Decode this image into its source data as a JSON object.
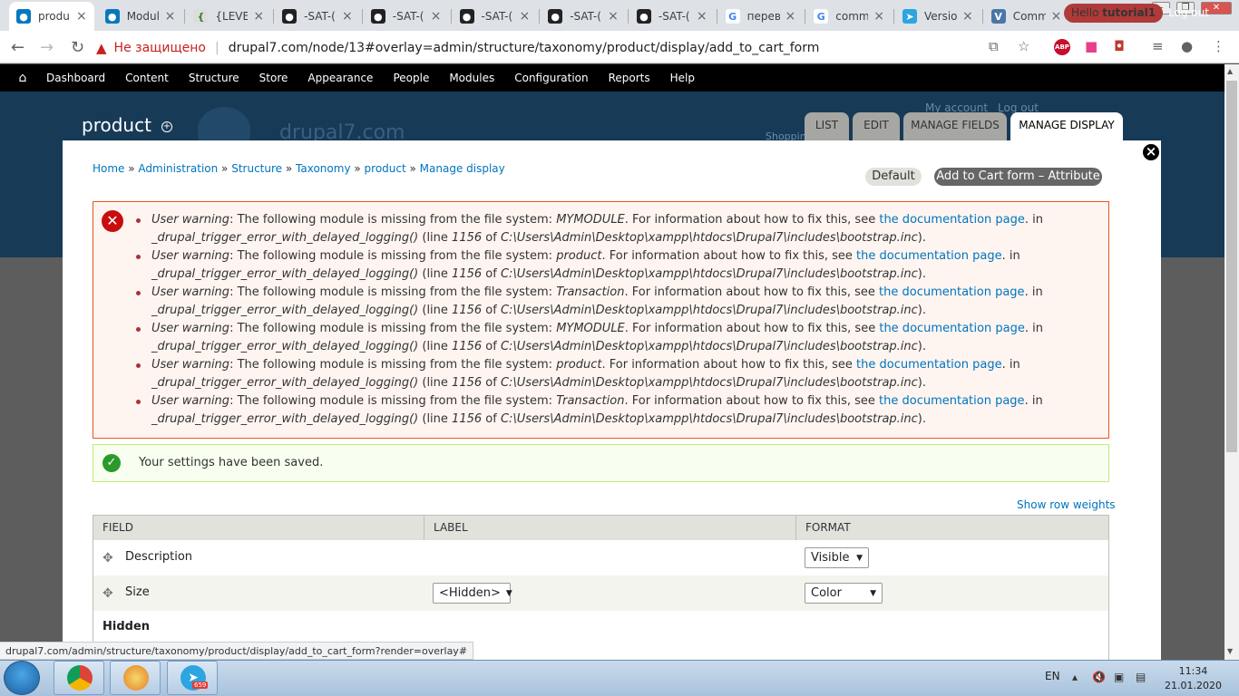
{
  "browser": {
    "tabs": [
      {
        "title": "produ",
        "active": true,
        "icon": "drupal-icon"
      },
      {
        "title": "Modul",
        "icon": "drupal-icon"
      },
      {
        "title": "{LEVEL",
        "icon": "level-icon"
      },
      {
        "title": "-SAT-(",
        "icon": "github-icon"
      },
      {
        "title": "-SAT-(",
        "icon": "github-icon"
      },
      {
        "title": "-SAT-(",
        "icon": "github-icon"
      },
      {
        "title": "-SAT-(",
        "icon": "github-icon"
      },
      {
        "title": "-SAT-(",
        "icon": "github-icon"
      },
      {
        "title": "перев",
        "icon": "google-icon"
      },
      {
        "title": "comm",
        "icon": "google-icon"
      },
      {
        "title": "Versio",
        "icon": "telegram-icon"
      },
      {
        "title": "Comm",
        "icon": "vk-icon"
      }
    ],
    "security_label": "Не защищено",
    "url": "drupal7.com/node/13#overlay=admin/structure/taxonomy/product/display/add_to_cart_form",
    "status_url": "drupal7.com/admin/structure/taxonomy/product/display/add_to_cart_form?render=overlay#"
  },
  "admin_toolbar": {
    "items": [
      "Dashboard",
      "Content",
      "Structure",
      "Store",
      "Appearance",
      "People",
      "Modules",
      "Configuration",
      "Reports",
      "Help"
    ],
    "hello_prefix": "Hello ",
    "hello_user": "tutorial1",
    "logout": "Log out"
  },
  "background": {
    "site_name": "drupal7.com",
    "my_account": "My account",
    "log_out": "Log out",
    "shopping": "Shoppin"
  },
  "overlay": {
    "title": "product",
    "tabs": [
      "LIST",
      "EDIT",
      "MANAGE FIELDS",
      "MANAGE DISPLAY"
    ],
    "breadcrumb": [
      "Home",
      "Administration",
      "Structure",
      "Taxonomy",
      "product",
      "Manage display"
    ],
    "subtabs": [
      "Default",
      "Add to Cart form – Attribute"
    ],
    "messages": {
      "errors": [
        {
          "type": "User warning",
          "text_a": ": The following module is missing from the file system: ",
          "module": "MYMODULE",
          "text_b": ". For information about how to fix this, see ",
          "link": "the documentation page",
          "text_c": ". in ",
          "func": "_drupal_trigger_error_with_delayed_logging()",
          "text_d": " (line ",
          "line": "1156",
          "text_e": " of ",
          "path": "C:\\Users\\Admin\\Desktop\\xampp\\htdocs\\Drupal7\\includes\\bootstrap.inc",
          "text_f": ")."
        },
        {
          "type": "User warning",
          "text_a": ": The following module is missing from the file system: ",
          "module": "product",
          "text_b": ". For information about how to fix this, see ",
          "link": "the documentation page",
          "text_c": ". in ",
          "func": "_drupal_trigger_error_with_delayed_logging()",
          "text_d": " (line ",
          "line": "1156",
          "text_e": " of ",
          "path": "C:\\Users\\Admin\\Desktop\\xampp\\htdocs\\Drupal7\\includes\\bootstrap.inc",
          "text_f": ")."
        },
        {
          "type": "User warning",
          "text_a": ": The following module is missing from the file system: ",
          "module": "Transaction",
          "text_b": ". For information about how to fix this, see ",
          "link": "the documentation page",
          "text_c": ". in ",
          "func": "_drupal_trigger_error_with_delayed_logging()",
          "text_d": " (line ",
          "line": "1156",
          "text_e": " of ",
          "path": "C:\\Users\\Admin\\Desktop\\xampp\\htdocs\\Drupal7\\includes\\bootstrap.inc",
          "text_f": ")."
        },
        {
          "type": "User warning",
          "text_a": ": The following module is missing from the file system: ",
          "module": "MYMODULE",
          "text_b": ". For information about how to fix this, see ",
          "link": "the documentation page",
          "text_c": ". in ",
          "func": "_drupal_trigger_error_with_delayed_logging()",
          "text_d": " (line ",
          "line": "1156",
          "text_e": " of ",
          "path": "C:\\Users\\Admin\\Desktop\\xampp\\htdocs\\Drupal7\\includes\\bootstrap.inc",
          "text_f": ")."
        },
        {
          "type": "User warning",
          "text_a": ": The following module is missing from the file system: ",
          "module": "product",
          "text_b": ". For information about how to fix this, see ",
          "link": "the documentation page",
          "text_c": ". in ",
          "func": "_drupal_trigger_error_with_delayed_logging()",
          "text_d": " (line ",
          "line": "1156",
          "text_e": " of ",
          "path": "C:\\Users\\Admin\\Desktop\\xampp\\htdocs\\Drupal7\\includes\\bootstrap.inc",
          "text_f": ")."
        },
        {
          "type": "User warning",
          "text_a": ": The following module is missing from the file system: ",
          "module": "Transaction",
          "text_b": ". For information about how to fix this, see ",
          "link": "the documentation page",
          "text_c": ". in ",
          "func": "_drupal_trigger_error_with_delayed_logging()",
          "text_d": " (line ",
          "line": "1156",
          "text_e": " of ",
          "path": "C:\\Users\\Admin\\Desktop\\xampp\\htdocs\\Drupal7\\includes\\bootstrap.inc",
          "text_f": ")."
        }
      ],
      "status": "Your settings have been saved."
    },
    "show_row_weights": "Show row weights",
    "table": {
      "headers": [
        "FIELD",
        "LABEL",
        "FORMAT"
      ],
      "rows": [
        {
          "field": "Description",
          "label": "",
          "format": "Visible"
        },
        {
          "field": "Size",
          "label": "<Hidden>",
          "format": "Color"
        }
      ],
      "hidden_region": "Hidden"
    }
  },
  "taskbar": {
    "lang": "EN",
    "time": "11:34",
    "date": "21.01.2020",
    "telegram_badge": "659"
  }
}
